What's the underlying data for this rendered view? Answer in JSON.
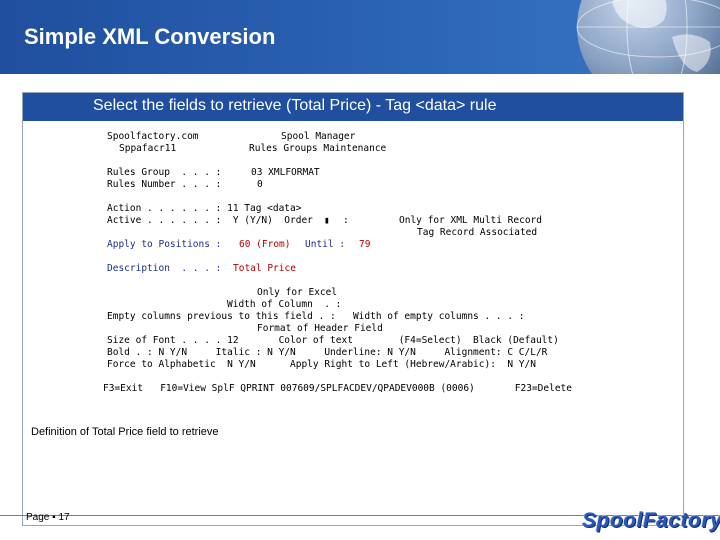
{
  "slide": {
    "title": "Simple XML Conversion",
    "page_label": "Page ▪ 17",
    "logo_text": "SpoolFactory"
  },
  "panel": {
    "title": "Select the fields to retrieve (Total Price) -  Tag <data> rule",
    "caption": "Definition of Total Price field to retrieve"
  },
  "screen": {
    "l1_left": "Spoolfactory.com",
    "l1_right": "Spool Manager",
    "l2_left": "Sppafacr11",
    "l2_right": "Rules Groups Maintenance",
    "rules_group": "Rules Group  . . . :",
    "rules_group_val": "03 XMLFORMAT",
    "rules_number": "Rules Number . . . :",
    "rules_number_val": "0",
    "action": "Action . . . . . . : 11 Tag <data>",
    "active": "Active . . . . . . :  Y (Y/N)  Order",
    "order_val": ":",
    "multi_record": "Only for XML Multi Record",
    "tag_record": "Tag Record Associated",
    "apply_label": "Apply to Positions :",
    "apply_from": "60 (From)",
    "apply_until": "Until :",
    "apply_until_val": "79",
    "desc_label": "Description  . . . :",
    "desc_val": "Total Price",
    "excel_only": "Only for Excel",
    "width_col": "Width of Column  . :",
    "empty_cols": "Empty columns previous to this field . :   Width of empty columns . . . :",
    "format_header": "Format of Header Field",
    "size_font": "Size of Font . . . . 12       Color of text        (F4=Select)  Black (Default)",
    "bold_line": "Bold . : N Y/N     Italic : N Y/N     Underline: N Y/N     Alignment: C C/L/R",
    "force_line": "Force to Alphabetic  N Y/N      Apply Right to Left (Hebrew/Arabic):  N Y/N",
    "fkeys": "F3=Exit   F10=View SplF QPRINT 007609/SPLFACDEV/QPADEV000B (0006)       F23=Delete"
  },
  "colors": {
    "header_blue": "#1f4f9e",
    "terminal_blue": "#1c2e8a",
    "terminal_red": "#b30000",
    "logo_blue": "#2c57b8"
  }
}
